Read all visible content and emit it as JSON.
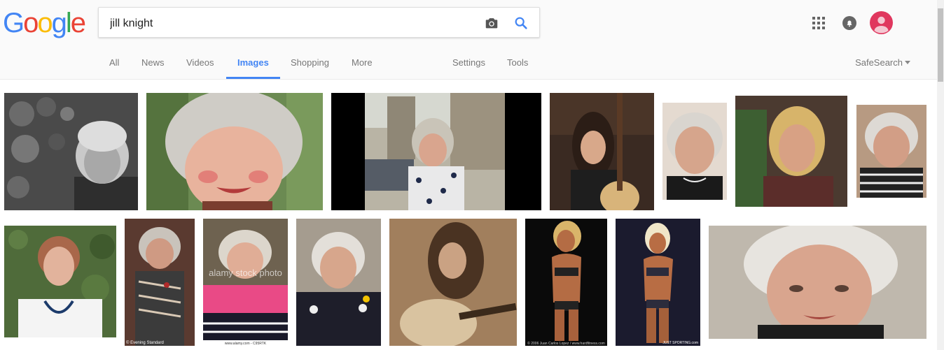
{
  "logo": {
    "letters": [
      "G",
      "o",
      "o",
      "g",
      "l",
      "e"
    ],
    "colors": [
      "#4285F4",
      "#EA4335",
      "#FBBC05",
      "#4285F4",
      "#34A853",
      "#EA4335"
    ]
  },
  "search": {
    "value": "jill knight",
    "camera_icon": "camera-icon",
    "search_icon": "search-icon"
  },
  "header_right": {
    "apps_icon": "apps-grid-icon",
    "notifications_icon": "notification-bell-icon",
    "avatar_color": "#e0375e"
  },
  "tabs": [
    {
      "label": "All"
    },
    {
      "label": "News"
    },
    {
      "label": "Videos"
    },
    {
      "label": "Images"
    },
    {
      "label": "Shopping"
    },
    {
      "label": "More"
    },
    {
      "label": "Settings"
    },
    {
      "label": "Tools"
    }
  ],
  "active_tab": "Images",
  "safesearch": {
    "label": "SafeSearch"
  },
  "accent_color": "#4285f4",
  "results": {
    "thumb_captions": {
      "r2_2": "© Evening Standard",
      "r2_3_watermark": "alamy stock photo",
      "r2_3": "www.alamy.com - C95RTK",
      "r2_6": "© 2006 Juan Carlos Lopez / www.hardfitness.com",
      "r2_7": "JUST SPORTING.com"
    }
  }
}
